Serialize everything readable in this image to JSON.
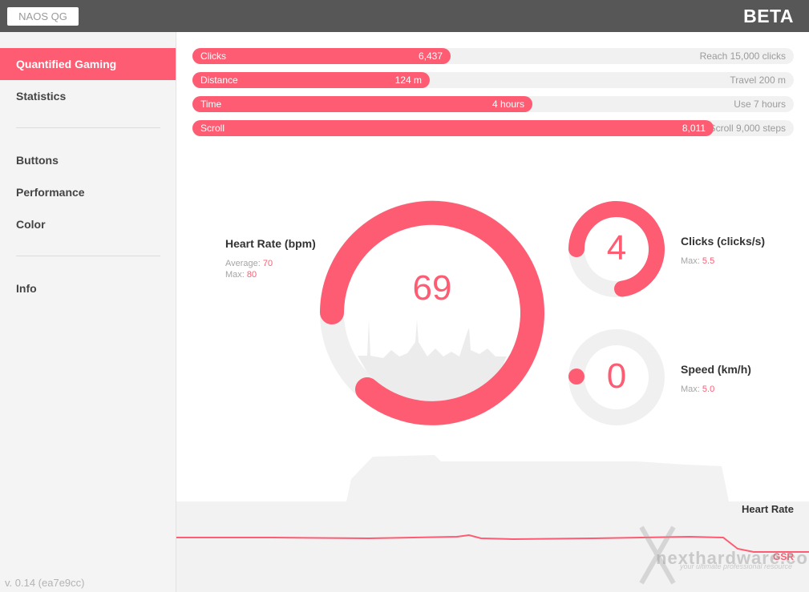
{
  "header": {
    "app_name": "NAOS QG",
    "badge": "BETA"
  },
  "sidebar": {
    "items": [
      {
        "label": "Quantified Gaming",
        "active": true
      },
      {
        "label": "Statistics"
      },
      {
        "label": "Buttons"
      },
      {
        "label": "Performance"
      },
      {
        "label": "Color"
      },
      {
        "label": "Info"
      }
    ],
    "version": "v. 0.14 (ea7e9cc)"
  },
  "progress": [
    {
      "label": "Clicks",
      "value": "6,437",
      "goal": "Reach 15,000 clicks",
      "fraction": 0.429
    },
    {
      "label": "Distance",
      "value": "124 m",
      "goal": "Travel 200 m",
      "fraction": 0.395
    },
    {
      "label": "Time",
      "value": "4 hours",
      "goal": "Use 7 hours",
      "fraction": 0.566
    },
    {
      "label": "Scroll",
      "value": "8,011",
      "goal": "Scroll 9,000 steps",
      "fraction": 0.867
    }
  ],
  "heart_rate": {
    "title": "Heart Rate (bpm)",
    "average_label": "Average:",
    "average": "70",
    "max_label": "Max:",
    "max": "80",
    "value": "69"
  },
  "clicks": {
    "title": "Clicks (clicks/s)",
    "max_label": "Max:",
    "max": "5.5",
    "value": "4"
  },
  "speed": {
    "title": "Speed (km/h)",
    "max_label": "Max:",
    "max": "5.0",
    "value": "0"
  },
  "charts": {
    "heart_rate_label": "Heart Rate",
    "gsr_label": "GSR"
  },
  "watermark": {
    "brand": "nexthardware.com",
    "tagline": "your ultimate professional resource"
  },
  "colors": {
    "accent": "#fd5c72",
    "topbar": "#575757",
    "track": "#f1f1f1"
  }
}
